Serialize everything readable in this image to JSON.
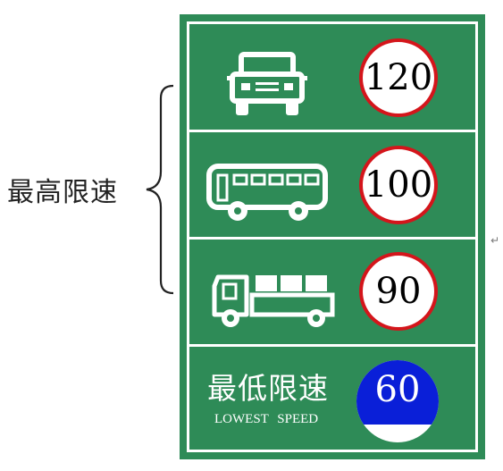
{
  "annotation": {
    "label": "最高限速",
    "return_mark": "↵"
  },
  "sign": {
    "background_color": "#2e8b57",
    "rows": [
      {
        "vehicle": "car-icon",
        "limit": "120",
        "limit_ring_color": "#d4151b"
      },
      {
        "vehicle": "bus-icon",
        "limit": "100",
        "limit_ring_color": "#d4151b"
      },
      {
        "vehicle": "truck-icon",
        "limit": "90",
        "limit_ring_color": "#d4151b"
      }
    ],
    "minimum": {
      "title": "最低限速",
      "subtitle": "LOWEST  SPEED",
      "limit": "60",
      "sign_color": "#0a1fd8"
    }
  }
}
